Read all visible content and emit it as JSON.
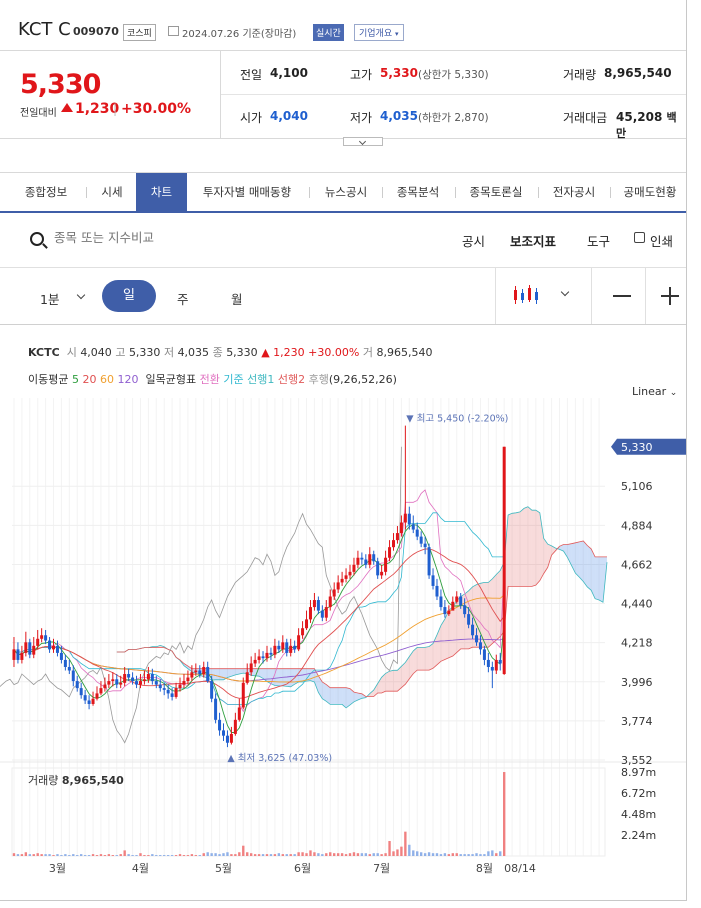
{
  "header": {
    "name": "KCT C",
    "code": "009070",
    "market": "코스피",
    "date": "2024.07.26",
    "date_suffix": "기준(장마감)",
    "realtime": "실시간",
    "company_info": "기업개요"
  },
  "price": {
    "current": "5,330",
    "change_label": "전일대비",
    "change_abs": "1,230",
    "change_sep": "|",
    "change_pct": "+30.00%"
  },
  "quotes": {
    "prev_label": "전일",
    "prev": "4,100",
    "high_label": "고가",
    "high": "5,330",
    "upper_limit": "(상한가 5,330)",
    "volume_label": "거래량",
    "volume": "8,965,540",
    "open_label": "시가",
    "open": "4,040",
    "low_label": "저가",
    "low": "4,035",
    "lower_limit": "(하한가 2,870)",
    "amount_label": "거래대금",
    "amount": "45,208",
    "amount_unit": "백만"
  },
  "tabs": [
    "종합정보",
    "시세",
    "차트",
    "투자자별 매매동향",
    "뉴스공시",
    "종목분석",
    "종목토론실",
    "전자공시",
    "공매도현황"
  ],
  "toolbar": {
    "search_placeholder": "종목 또는 지수비교",
    "disclosure": "공시",
    "indicators": "보조지표",
    "tools": "도구",
    "print": "인쇄"
  },
  "periods": {
    "minute": "1분",
    "day": "일",
    "week": "주",
    "month": "월"
  },
  "info_line": {
    "name": "KCTC",
    "open_label": "시",
    "open": "4,040",
    "high_label": "고",
    "high": "5,330",
    "low_label": "저",
    "low": "4,035",
    "close_label": "종",
    "close": "5,330",
    "change": "1,230",
    "pct": "+30.00%",
    "vol_label": "거",
    "vol": "8,965,540"
  },
  "indicator_line": {
    "ma_label": "이동평균",
    "ma5": "5",
    "ma20": "20",
    "ma60": "60",
    "ma120": "120",
    "ichimoku_label": "일목균형표",
    "conv": "전환",
    "base": "기준",
    "span1": "선행1",
    "span2": "선행2",
    "lag": "후행",
    "params": "(9,26,52,26)"
  },
  "scale_mode": "Linear",
  "colors": {
    "up": "#e0161a",
    "down": "#1f5fcf",
    "accent": "#3f5ea8",
    "ma5": "#2e9e3e",
    "ma20": "#e05050",
    "ma60": "#f0a030",
    "ma120": "#9060d0",
    "conv": "#e070c0",
    "base": "#30b8d0",
    "span1": "#3fb8c0",
    "span2": "#e05a5a",
    "lag": "#999999"
  },
  "chart_data": {
    "type": "candlestick",
    "y_ticks": [
      "5,106",
      "4,884",
      "4,662",
      "4,440",
      "4,218",
      "3,996",
      "3,774",
      "3,552"
    ],
    "y_tick_values": [
      5106,
      4884,
      4662,
      4440,
      4218,
      3996,
      3774,
      3552
    ],
    "ylim": [
      3552,
      5550
    ],
    "x_ticks": [
      "3월",
      "4월",
      "5월",
      "6월",
      "7월",
      "8월",
      "08/14"
    ],
    "x_tick_index": [
      11,
      32,
      53,
      73,
      93,
      119,
      128
    ],
    "n_slots": 150,
    "current_price_label": "5,330",
    "current_price": 5330,
    "max_label": "▼ 최고 5,450 (-2.20%)",
    "max_value": 5450,
    "max_index": 100,
    "min_label": "▲ 최저 3,625 (47.03%)",
    "min_value": 3625,
    "min_index": 55,
    "volume_title": "거래량",
    "volume_value": "8,965,540",
    "volume_ticks": [
      "8.97m",
      "6.72m",
      "4.48m",
      "2.24m"
    ],
    "volume_tick_values": [
      8.97,
      6.72,
      4.48,
      2.24
    ],
    "close": [
      4180,
      4120,
      4160,
      4220,
      4150,
      4200,
      4240,
      4260,
      4230,
      4180,
      4200,
      4160,
      4120,
      4080,
      4060,
      4000,
      3960,
      3920,
      3890,
      3870,
      3900,
      3930,
      3960,
      3980,
      4000,
      4010,
      3980,
      3990,
      4040,
      4020,
      4000,
      3980,
      4000,
      4010,
      4040,
      4000,
      3980,
      3960,
      3950,
      3930,
      3910,
      3960,
      3980,
      4000,
      4020,
      4050,
      4060,
      4040,
      4080,
      4000,
      3900,
      3780,
      3720,
      3690,
      3650,
      3700,
      3780,
      3850,
      3990,
      4050,
      4100,
      4120,
      4140,
      4130,
      4160,
      4150,
      4200,
      4180,
      4220,
      4160,
      4200,
      4180,
      4260,
      4300,
      4350,
      4420,
      4460,
      4400,
      4360,
      4420,
      4480,
      4520,
      4560,
      4580,
      4600,
      4620,
      4660,
      4700,
      4690,
      4660,
      4720,
      4680,
      4600,
      4620,
      4700,
      4760,
      4800,
      4840,
      4900,
      4950,
      4890,
      4860,
      4820,
      4780,
      4760,
      4600,
      4540,
      4480,
      4420,
      4380,
      4400,
      4450,
      4480,
      4430,
      4380,
      4320,
      4260,
      4220,
      4180,
      4120,
      4080,
      4060,
      4120,
      4100,
      5330
    ],
    "open": [
      4120,
      4180,
      4120,
      4160,
      4220,
      4150,
      4200,
      4240,
      4260,
      4230,
      4180,
      4200,
      4160,
      4120,
      4080,
      4060,
      4000,
      3960,
      3920,
      3890,
      3870,
      3900,
      3930,
      3960,
      3980,
      4000,
      4010,
      3980,
      3990,
      4040,
      4020,
      4000,
      3980,
      4000,
      4010,
      4040,
      4000,
      3980,
      3960,
      3950,
      3930,
      3910,
      3960,
      3980,
      4000,
      4020,
      4050,
      4060,
      4040,
      4080,
      4000,
      3900,
      3780,
      3720,
      3690,
      3650,
      3700,
      3780,
      3850,
      3990,
      4050,
      4100,
      4120,
      4140,
      4130,
      4160,
      4150,
      4200,
      4180,
      4220,
      4160,
      4200,
      4180,
      4260,
      4300,
      4350,
      4420,
      4460,
      4400,
      4360,
      4420,
      4480,
      4520,
      4560,
      4580,
      4600,
      4620,
      4660,
      4700,
      4690,
      4660,
      4720,
      4680,
      4600,
      4620,
      4700,
      4760,
      4800,
      4840,
      4900,
      4950,
      4890,
      4860,
      4820,
      4780,
      4760,
      4600,
      4540,
      4480,
      4420,
      4380,
      4400,
      4450,
      4480,
      4430,
      4380,
      4320,
      4260,
      4220,
      4180,
      4120,
      4080,
      4060,
      4120,
      4040
    ],
    "high": [
      4250,
      4220,
      4200,
      4280,
      4240,
      4250,
      4290,
      4300,
      4290,
      4250,
      4240,
      4230,
      4200,
      4150,
      4120,
      4090,
      4030,
      3990,
      3950,
      3920,
      3940,
      3970,
      4000,
      4020,
      4040,
      4050,
      4040,
      4030,
      4080,
      4070,
      4050,
      4030,
      4040,
      4060,
      4080,
      4070,
      4030,
      4010,
      3990,
      3980,
      3960,
      3990,
      4020,
      4040,
      4060,
      4090,
      4100,
      4090,
      4110,
      4110,
      4030,
      3930,
      3820,
      3760,
      3720,
      3740,
      3820,
      3900,
      4020,
      4100,
      4140,
      4160,
      4180,
      4170,
      4200,
      4190,
      4240,
      4230,
      4260,
      4240,
      4240,
      4230,
      4300,
      4340,
      4400,
      4460,
      4500,
      4480,
      4430,
      4460,
      4520,
      4560,
      4600,
      4620,
      4640,
      4660,
      4700,
      4740,
      4730,
      4720,
      4760,
      4740,
      4700,
      4660,
      4740,
      4800,
      4840,
      4880,
      4940,
      5450,
      4990,
      4940,
      4900,
      4850,
      4820,
      4780,
      4640,
      4580,
      4520,
      4460,
      4430,
      4480,
      4510,
      4500,
      4470,
      4420,
      4360,
      4300,
      4260,
      4200,
      4160,
      4110,
      4150,
      4160,
      5330
    ],
    "low": [
      4080,
      4100,
      4100,
      4140,
      4130,
      4130,
      4180,
      4220,
      4210,
      4160,
      4160,
      4140,
      4100,
      4060,
      4040,
      3970,
      3940,
      3900,
      3870,
      3840,
      3860,
      3890,
      3920,
      3940,
      3960,
      3970,
      3960,
      3960,
      3970,
      4000,
      3980,
      3960,
      3960,
      3980,
      3990,
      3980,
      3960,
      3940,
      3920,
      3900,
      3890,
      3900,
      3940,
      3960,
      3980,
      4000,
      4030,
      4020,
      4020,
      3990,
      3880,
      3760,
      3690,
      3660,
      3625,
      3640,
      3690,
      3770,
      3840,
      3980,
      4030,
      4080,
      4100,
      4100,
      4110,
      4120,
      4130,
      4160,
      4160,
      4140,
      4140,
      4160,
      4170,
      4240,
      4290,
      4330,
      4400,
      4380,
      4340,
      4340,
      4400,
      4460,
      4500,
      4540,
      4560,
      4580,
      4600,
      4640,
      4660,
      4640,
      4640,
      4660,
      4580,
      4580,
      4600,
      4680,
      4740,
      4780,
      4820,
      4860,
      4860,
      4840,
      4800,
      4760,
      4720,
      4580,
      4520,
      4460,
      4400,
      4360,
      4370,
      4420,
      4440,
      4410,
      4360,
      4300,
      4240,
      4200,
      4150,
      4090,
      4050,
      3960,
      4040,
      4060,
      4035
    ],
    "volume": [
      0.3,
      0.2,
      0.2,
      0.4,
      0.2,
      0.2,
      0.3,
      0.2,
      0.2,
      0.2,
      0.1,
      0.2,
      0.1,
      0.2,
      0.1,
      0.2,
      0.1,
      0.2,
      0.1,
      0.1,
      0.2,
      0.1,
      0.2,
      0.1,
      0.2,
      0.1,
      0.1,
      0.2,
      0.6,
      0.2,
      0.1,
      0.1,
      0.3,
      0.1,
      0.1,
      0.2,
      0.1,
      0.1,
      0.1,
      0.1,
      0.1,
      0.1,
      0.2,
      0.1,
      0.1,
      0.2,
      0.1,
      0.1,
      0.3,
      0.4,
      0.3,
      0.3,
      0.2,
      0.3,
      0.4,
      0.2,
      0.2,
      0.4,
      1.1,
      0.4,
      0.3,
      0.2,
      0.2,
      0.2,
      0.2,
      0.2,
      0.2,
      0.3,
      0.2,
      0.2,
      0.2,
      0.2,
      0.4,
      0.4,
      0.3,
      0.6,
      0.4,
      0.3,
      0.2,
      0.3,
      0.4,
      0.3,
      0.3,
      0.3,
      0.2,
      0.3,
      0.4,
      0.3,
      0.3,
      0.3,
      0.2,
      0.3,
      0.3,
      0.2,
      0.3,
      1.6,
      0.5,
      0.7,
      1.0,
      2.6,
      1.2,
      0.6,
      0.5,
      0.4,
      0.3,
      0.4,
      0.3,
      0.3,
      0.2,
      0.3,
      0.2,
      0.3,
      0.3,
      0.2,
      0.2,
      0.2,
      0.2,
      0.3,
      0.2,
      0.2,
      0.5,
      0.6,
      0.3,
      0.5,
      8.97
    ]
  }
}
